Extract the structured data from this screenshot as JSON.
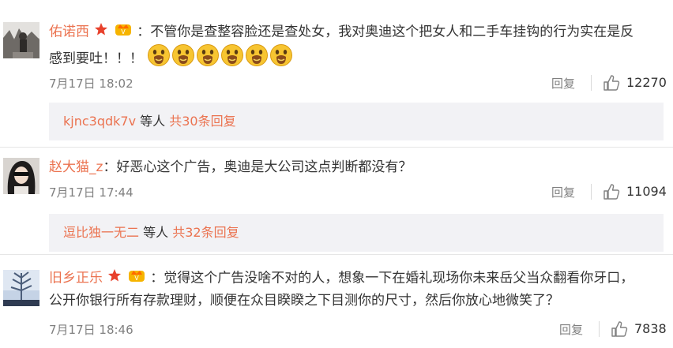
{
  "comments": [
    {
      "username": "佑诺西",
      "text_line1": "：不管你是查整容脸还是查处女，我对奥迪这个把女人和二手车挂钩的行为实在是反",
      "text_line2": "感到要吐！！！",
      "emoji_name": "vomit-emoji",
      "emoji_count": 6,
      "time": "7月17日 18:02",
      "reply_label": "回复",
      "likes": "12270",
      "thread_names": "kjnc3qdk7v",
      "thread_mid": " 等人 ",
      "thread_count": "共30条回复"
    },
    {
      "username": "赵大猫_z",
      "text_line1": "：好恶心这个广告，奥迪是大公司这点判断都没有？",
      "time": "7月17日 17:44",
      "reply_label": "回复",
      "likes": "11094",
      "thread_names": "逗比独一无二",
      "thread_mid": " 等人 ",
      "thread_count": "共32条回复"
    },
    {
      "username": "旧乡正乐",
      "text_line1": "：觉得这个广告没啥不对的人，想象一下在婚礼现场你未来岳父当众翻看你牙口，",
      "text_line2": "公开你银行所有存款理财，顺便在众目睽睽之下目测你的尺寸，然后你放心地微笑了？",
      "time": "7月17日 18:46",
      "reply_label": "回复",
      "likes": "7838"
    }
  ],
  "colors": {
    "username": "#eb7350",
    "text": "#333333",
    "meta": "#808080",
    "subbox_bg": "#f2f2f5"
  }
}
